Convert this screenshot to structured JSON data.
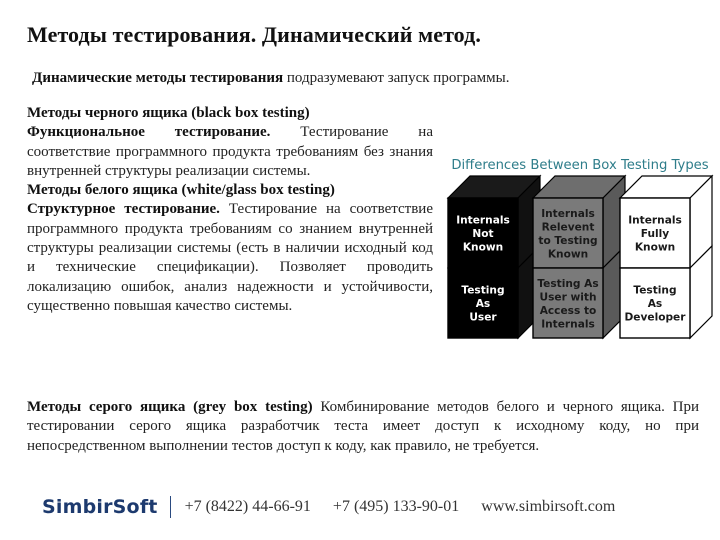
{
  "slide": {
    "title": "Методы тестирования. Динамический метод.",
    "intro": {
      "bold": "Динамические методы тестирования",
      "rest": " подразумевают запуск программы."
    },
    "black_box": {
      "heading": "Методы черного ящика (black box testing)",
      "lead_bold": "Функциональное тестирование.",
      "text": " Тестирование на соответствие программного продукта требованиям без знания внутренней структуры реализации системы."
    },
    "white_box": {
      "heading": "Методы белого ящика (white/glass box testing)",
      "lead_bold": "Структурное тестирование.",
      "text": " Тестирование на соответствие программного продукта требованиям со знанием внутренней структуры реализации системы (есть в наличии исходный код и технические спецификации). Позволяет проводить локализацию ошибок, анализ надежности и устойчивости, существенно повышая качество системы."
    },
    "grey_box": {
      "lead_bold": "Методы серого ящика (grey box testing)",
      "text": " Комбинирование методов белого и черного ящика. При тестировании серого ящика разработчик теста имеет доступ к исходному коду, но при непосредственном выполнении тестов доступ к коду, как правило, не требуется."
    }
  },
  "diagram": {
    "title": "Differences Between Box Testing Types",
    "title_color": "#2e7d8a",
    "columns": [
      {
        "name": "black",
        "face_color": "#000000",
        "text_color": "#ffffff",
        "top_label": [
          "Internals",
          "Not",
          "Known"
        ],
        "bottom_label": [
          "Testing",
          "As",
          "User"
        ]
      },
      {
        "name": "grey",
        "face_color": "#7a7a7a",
        "text_color": "#1a1a1a",
        "top_label": [
          "Internals",
          "Relevent",
          "to Testing",
          "Known"
        ],
        "bottom_label": [
          "Testing As",
          "User with",
          "Access to",
          "Internals"
        ]
      },
      {
        "name": "white",
        "face_color": "#ffffff",
        "text_color": "#1a1a1a",
        "top_label": [
          "Internals",
          "Fully",
          "Known"
        ],
        "bottom_label": [
          "Testing",
          "As",
          "Developer"
        ]
      }
    ]
  },
  "footer": {
    "logo": "SimbirSoft",
    "phone1": "+7 (8422) 44-66-91",
    "phone2": "+7 (495) 133-90-01",
    "website": "www.simbirsoft.com"
  }
}
